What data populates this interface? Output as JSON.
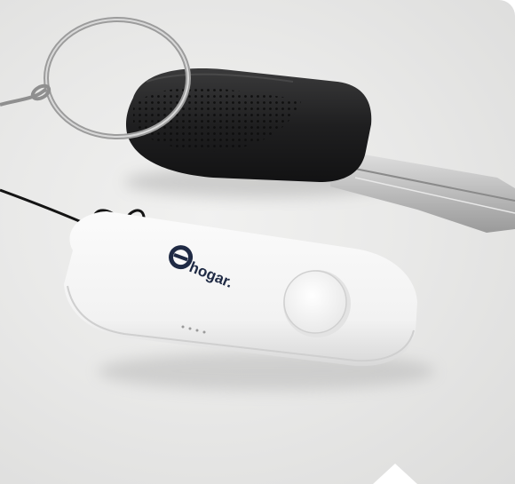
{
  "photo": {
    "subject": "key-with-bluetooth-tracker",
    "tracker": {
      "brand_label": "hogar.",
      "color": "#f7f7f7",
      "logo_color": "#1f2a44"
    },
    "key": {
      "head_color": "#1e1e1f",
      "blade_color": "#c9c9c9"
    },
    "background_color": "#e8e8e7"
  }
}
